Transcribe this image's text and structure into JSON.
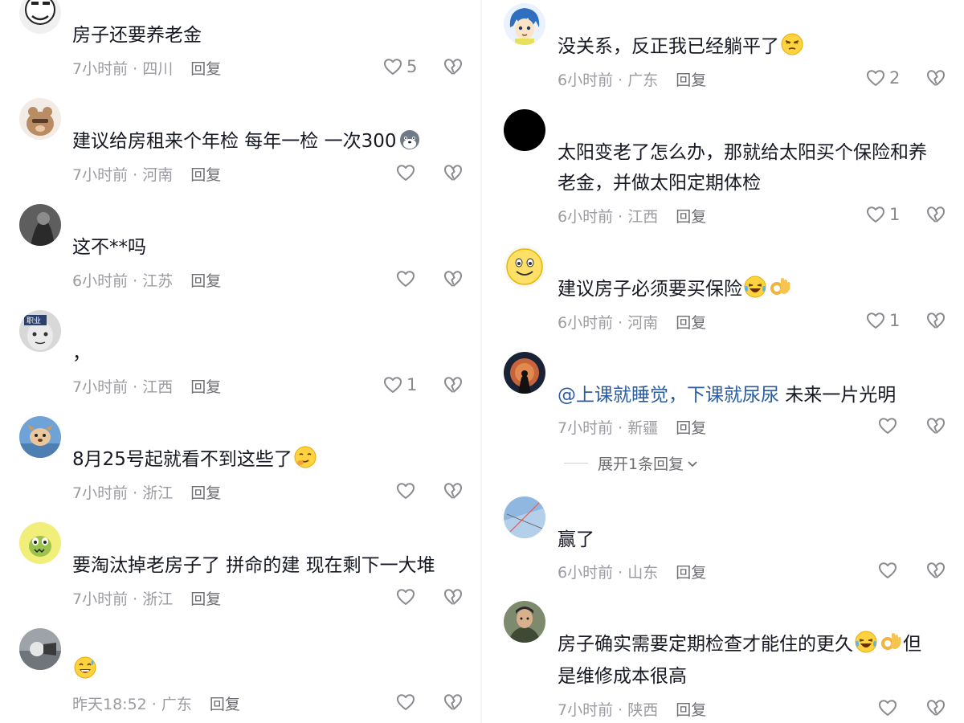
{
  "left": [
    {
      "text": "房子还要养老金",
      "emoji": "",
      "time": "7小时前 · 四川",
      "reply": "回复",
      "likes": "5",
      "username": ""
    },
    {
      "text": "建议给房租来个年检 每年一检 一次300",
      "emoji": "dog-emoji",
      "time": "7小时前 · 河南",
      "reply": "回复",
      "likes": "",
      "username": ""
    },
    {
      "text": "这不**吗",
      "emoji": "",
      "time": "6小时前 · 江苏",
      "reply": "回复",
      "likes": "",
      "username": ""
    },
    {
      "text": "，",
      "emoji": "",
      "time": "7小时前 · 江西",
      "reply": "回复",
      "likes": "1",
      "username": ""
    },
    {
      "text": "8月25号起就看不到这些了",
      "emoji": "smirk-emoji",
      "time": "7小时前 · 浙江",
      "reply": "回复",
      "likes": "",
      "username": ""
    },
    {
      "text": "要淘汰掉老房子了  拼命的建  现在剩下一大堆",
      "emoji": "",
      "time": "7小时前 · 浙江",
      "reply": "回复",
      "likes": "",
      "username": ""
    },
    {
      "text": "",
      "emoji": "sweat-smile-emoji",
      "time": "昨天18:52 · 广东",
      "reply": "回复",
      "likes": "",
      "username": ""
    }
  ],
  "right": [
    {
      "text": "没关系，反正我已经躺平了",
      "emoji": "squint-emoji",
      "time": "6小时前 · 广东",
      "reply": "回复",
      "likes": "2",
      "username": ""
    },
    {
      "text": "太阳变老了怎么办，那就给太阳买个保险和养",
      "text2": "老金，并做太阳定期体检",
      "emoji": "",
      "time": "6小时前 · 江西",
      "reply": "回复",
      "likes": "1",
      "username": ""
    },
    {
      "text": "建议房子必须要买保险",
      "emoji": "laugh-cry-ok-emoji",
      "time": "6小时前 · 河南",
      "reply": "回复",
      "likes": "1",
      "username": ""
    },
    {
      "mention": "@上课就睡觉，下课就尿尿",
      "text": " 未来一片光明",
      "emoji": "",
      "time": "7小时前 · 新疆",
      "reply": "回复",
      "likes": "",
      "username": "",
      "expand": "展开1条回复"
    },
    {
      "text": "赢了",
      "emoji": "",
      "time": "6小时前 · 山东",
      "reply": "回复",
      "likes": "",
      "username": ""
    },
    {
      "text": "房子确实需要定期检查才能住的更久",
      "text_after": "但",
      "text2": "是维修成本很高",
      "emoji": "laugh-cry-ok-emoji",
      "time": "7小时前 · 陕西",
      "reply": "回复",
      "likes": "",
      "username": ""
    }
  ],
  "icons": {
    "like": "heart-outline-icon",
    "dislike": "broken-heart-icon",
    "expand": "chevron-down-icon"
  },
  "colors": {
    "text": "#161823",
    "meta": "#9b9ba1",
    "mention": "#2b5c9e",
    "icon": "#8a8a90"
  }
}
